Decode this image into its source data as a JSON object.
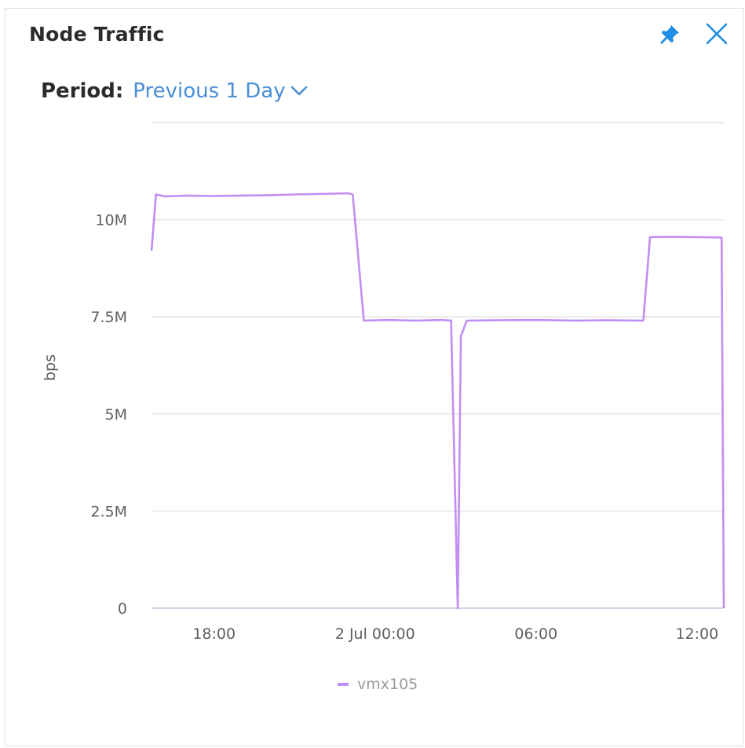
{
  "panel": {
    "title": "Node Traffic",
    "period_label": "Period:",
    "period_value": "Previous 1 Day",
    "pin_icon": "pin-icon",
    "close_icon": "close-icon",
    "accent_color": "#4a8fd6"
  },
  "chart_data": {
    "type": "line",
    "ylabel": "bps",
    "ylim": [
      0,
      12500000
    ],
    "y_ticks": [
      0,
      2500000,
      5000000,
      7500000,
      10000000
    ],
    "y_tick_labels": [
      "0",
      "2.5M",
      "5M",
      "7.5M",
      "10M"
    ],
    "x_ticks": [
      "2024-07-01T18:00",
      "2024-07-02T00:00",
      "2024-07-02T06:00",
      "2024-07-02T12:00"
    ],
    "x_tick_labels": [
      "18:00",
      "2 Jul 00:00",
      "06:00",
      "12:00"
    ],
    "xlim": [
      "2024-07-01T15:40",
      "2024-07-02T13:00"
    ],
    "grid": true,
    "legend_placement": "bottom-center",
    "series": [
      {
        "name": "vmx105",
        "color": "#c08ef5",
        "points": [
          [
            "2024-07-01T15:40",
            9200000
          ],
          [
            "2024-07-01T15:50",
            10650000
          ],
          [
            "2024-07-01T16:10",
            10600000
          ],
          [
            "2024-07-01T17:00",
            10620000
          ],
          [
            "2024-07-01T18:00",
            10610000
          ],
          [
            "2024-07-01T19:00",
            10620000
          ],
          [
            "2024-07-01T20:00",
            10630000
          ],
          [
            "2024-07-01T21:00",
            10650000
          ],
          [
            "2024-07-01T23:00",
            10680000
          ],
          [
            "2024-07-01T23:10",
            10650000
          ],
          [
            "2024-07-01T23:35",
            7400000
          ],
          [
            "2024-07-02T00:30",
            7420000
          ],
          [
            "2024-07-02T01:30",
            7400000
          ],
          [
            "2024-07-02T02:30",
            7420000
          ],
          [
            "2024-07-02T02:50",
            7400000
          ],
          [
            "2024-07-02T03:05",
            0
          ],
          [
            "2024-07-02T03:12",
            7000000
          ],
          [
            "2024-07-02T03:25",
            7400000
          ],
          [
            "2024-07-02T04:30",
            7410000
          ],
          [
            "2024-07-02T06:00",
            7420000
          ],
          [
            "2024-07-02T07:30",
            7400000
          ],
          [
            "2024-07-02T08:30",
            7410000
          ],
          [
            "2024-07-02T10:00",
            7400000
          ],
          [
            "2024-07-02T10:15",
            9550000
          ],
          [
            "2024-07-02T11:00",
            9560000
          ],
          [
            "2024-07-02T12:00",
            9550000
          ],
          [
            "2024-07-02T12:55",
            9540000
          ],
          [
            "2024-07-02T13:00",
            0
          ]
        ]
      }
    ]
  }
}
